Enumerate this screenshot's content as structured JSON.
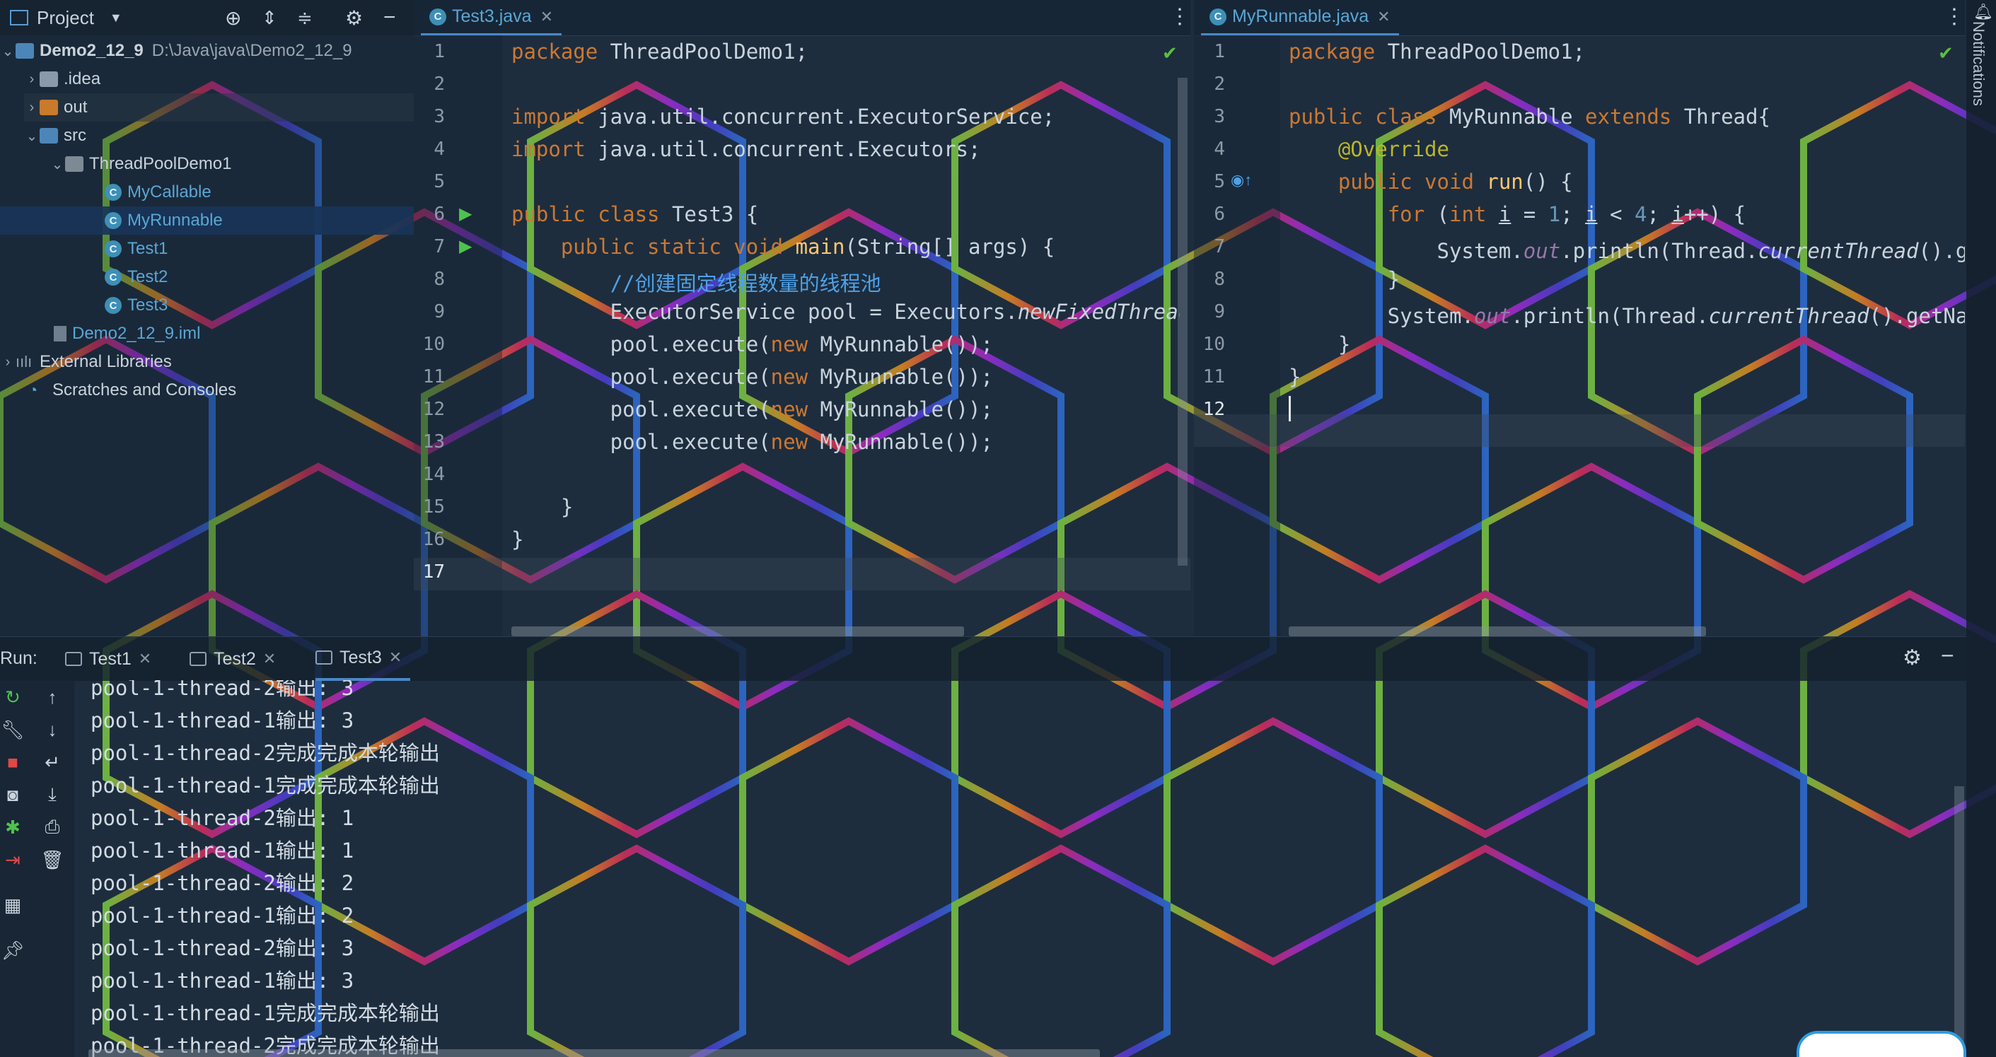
{
  "project_panel": {
    "title": "Project",
    "tree": [
      {
        "label": "Demo2_12_9",
        "path": "D:\\Java\\java\\Demo2_12_9"
      },
      {
        "label": ".idea"
      },
      {
        "label": "out"
      },
      {
        "label": "src"
      },
      {
        "label": "ThreadPoolDemo1"
      },
      {
        "label": "MyCallable"
      },
      {
        "label": "MyRunnable"
      },
      {
        "label": "Test1"
      },
      {
        "label": "Test2"
      },
      {
        "label": "Test3"
      },
      {
        "label": "Demo2_12_9.iml"
      },
      {
        "label": "External Libraries"
      },
      {
        "label": "Scratches and Consoles"
      }
    ]
  },
  "editor_left": {
    "tab_label": "Test3.java",
    "line_numbers": [
      "1",
      "2",
      "3",
      "4",
      "5",
      "6",
      "7",
      "8",
      "9",
      "10",
      "11",
      "12",
      "13",
      "14",
      "15",
      "16",
      "17"
    ]
  },
  "editor_right": {
    "tab_label": "MyRunnable.java",
    "line_numbers": [
      "1",
      "2",
      "3",
      "4",
      "5",
      "6",
      "7",
      "8",
      "9",
      "10",
      "11",
      "12"
    ]
  },
  "run_panel": {
    "label": "Run:",
    "tabs": [
      "Test1",
      "Test2",
      "Test3"
    ],
    "output": [
      "pool-1-thread-2输出: 3",
      "pool-1-thread-1输出: 3",
      "pool-1-thread-2完成完成本轮输出",
      "pool-1-thread-1完成完成本轮输出",
      "pool-1-thread-2输出: 1",
      "pool-1-thread-1输出: 1",
      "pool-1-thread-2输出: 2",
      "pool-1-thread-1输出: 2",
      "pool-1-thread-2输出: 3",
      "pool-1-thread-1输出: 3",
      "pool-1-thread-1完成完成本轮输出",
      "pool-1-thread-2完成完成本轮输出"
    ]
  },
  "notifications": {
    "label": "Notifications"
  },
  "colors": {
    "accent": "#4a88c7",
    "keyword": "#cc7832",
    "function": "#ffc66d",
    "comment": "#4ea1e6"
  }
}
